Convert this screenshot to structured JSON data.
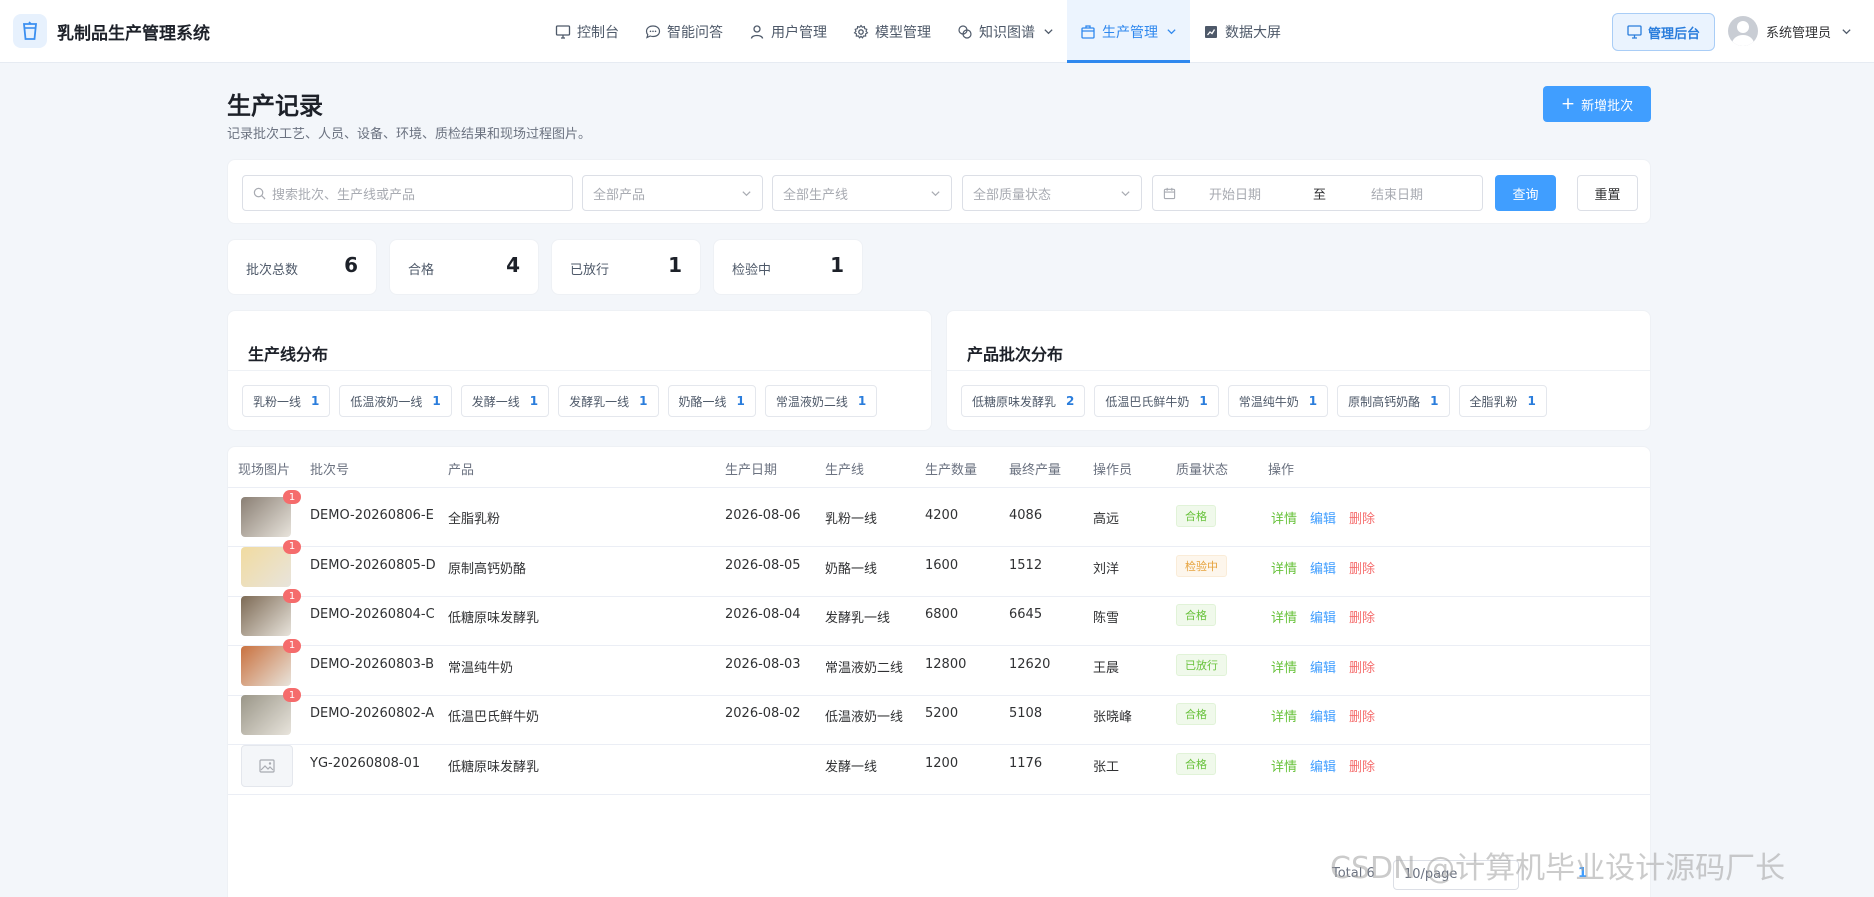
{
  "app": {
    "title": "乳制品生产管理系统"
  },
  "nav": [
    {
      "label": "控制台",
      "icon": "monitor-icon"
    },
    {
      "label": "智能问答",
      "icon": "chat-icon"
    },
    {
      "label": "用户管理",
      "icon": "user-icon"
    },
    {
      "label": "模型管理",
      "icon": "gear-icon"
    },
    {
      "label": "知识图谱",
      "icon": "graph-icon"
    },
    {
      "label": "生产管理",
      "icon": "box-icon"
    },
    {
      "label": "数据大屏",
      "icon": "chart-icon"
    }
  ],
  "header": {
    "admin_label": "管理后台",
    "user_name": "系统管理员"
  },
  "page": {
    "title": "生产记录",
    "subtitle": "记录批次工艺、人员、设备、环境、质检结果和现场过程图片。",
    "add_label": "新增批次"
  },
  "filters": {
    "search_placeholder": "搜索批次、生产线或产品",
    "product": "全部产品",
    "line": "全部生产线",
    "quality": "全部质量状态",
    "start_date": "开始日期",
    "to": "至",
    "end_date": "结束日期",
    "query_label": "查询",
    "reset_label": "重置"
  },
  "stats": [
    {
      "label": "批次总数",
      "value": "6"
    },
    {
      "label": "合格",
      "value": "4"
    },
    {
      "label": "已放行",
      "value": "1"
    },
    {
      "label": "检验中",
      "value": "1"
    }
  ],
  "line_dist": {
    "title": "生产线分布",
    "items": [
      {
        "label": "乳粉一线",
        "count": "1"
      },
      {
        "label": "低温液奶一线",
        "count": "1"
      },
      {
        "label": "发酵一线",
        "count": "1"
      },
      {
        "label": "发酵乳一线",
        "count": "1"
      },
      {
        "label": "奶酪一线",
        "count": "1"
      },
      {
        "label": "常温液奶二线",
        "count": "1"
      }
    ]
  },
  "product_dist": {
    "title": "产品批次分布",
    "items": [
      {
        "label": "低糖原味发酵乳",
        "count": "2"
      },
      {
        "label": "低温巴氏鲜牛奶",
        "count": "1"
      },
      {
        "label": "常温纯牛奶",
        "count": "1"
      },
      {
        "label": "原制高钙奶酪",
        "count": "1"
      },
      {
        "label": "全脂乳粉",
        "count": "1"
      }
    ]
  },
  "table": {
    "columns": [
      "现场图片",
      "批次号",
      "产品",
      "生产日期",
      "生产线",
      "生产数量",
      "最终产量",
      "操作员",
      "质量状态",
      "操作"
    ],
    "rows": [
      {
        "photos": "1",
        "batch": "DEMO-20260806-E",
        "product": "全脂乳粉",
        "date": "2026-08-06",
        "line": "乳粉一线",
        "qty": "4200",
        "final": "4086",
        "operator": "高远",
        "status": "合格",
        "status_type": "ok",
        "thumb_color": "#8a7f74"
      },
      {
        "photos": "1",
        "batch": "DEMO-20260805-D",
        "product": "原制高钙奶酪",
        "date": "2026-08-05",
        "line": "奶酪一线",
        "qty": "1600",
        "final": "1512",
        "operator": "刘洋",
        "status": "检验中",
        "status_type": "check",
        "thumb_color": "#f1dba0"
      },
      {
        "photos": "1",
        "batch": "DEMO-20260804-C",
        "product": "低糖原味发酵乳",
        "date": "2026-08-04",
        "line": "发酵乳一线",
        "qty": "6800",
        "final": "6645",
        "operator": "陈雪",
        "status": "合格",
        "status_type": "ok",
        "thumb_color": "#7d6a55"
      },
      {
        "photos": "1",
        "batch": "DEMO-20260803-B",
        "product": "常温纯牛奶",
        "date": "2026-08-03",
        "line": "常温液奶二线",
        "qty": "12800",
        "final": "12620",
        "operator": "王晨",
        "status": "已放行",
        "status_type": "ok",
        "thumb_color": "#c9713f"
      },
      {
        "photos": "1",
        "batch": "DEMO-20260802-A",
        "product": "低温巴氏鲜牛奶",
        "date": "2026-08-02",
        "line": "低温液奶一线",
        "qty": "5200",
        "final": "5108",
        "operator": "张晓峰",
        "status": "合格",
        "status_type": "ok",
        "thumb_color": "#9a9688"
      },
      {
        "photos": "",
        "batch": "YG-20260808-01",
        "product": "低糖原味发酵乳",
        "date": "",
        "line": "发酵一线",
        "qty": "1200",
        "final": "1176",
        "operator": "张工",
        "status": "合格",
        "status_type": "ok",
        "thumb_color": ""
      }
    ],
    "actions": {
      "detail": "详情",
      "edit": "编辑",
      "delete": "删除"
    }
  },
  "pager": {
    "total": "Total 6",
    "page_size": "10/page",
    "page": "1"
  },
  "watermark": "CSDN @计算机毕业设计源码厂长"
}
